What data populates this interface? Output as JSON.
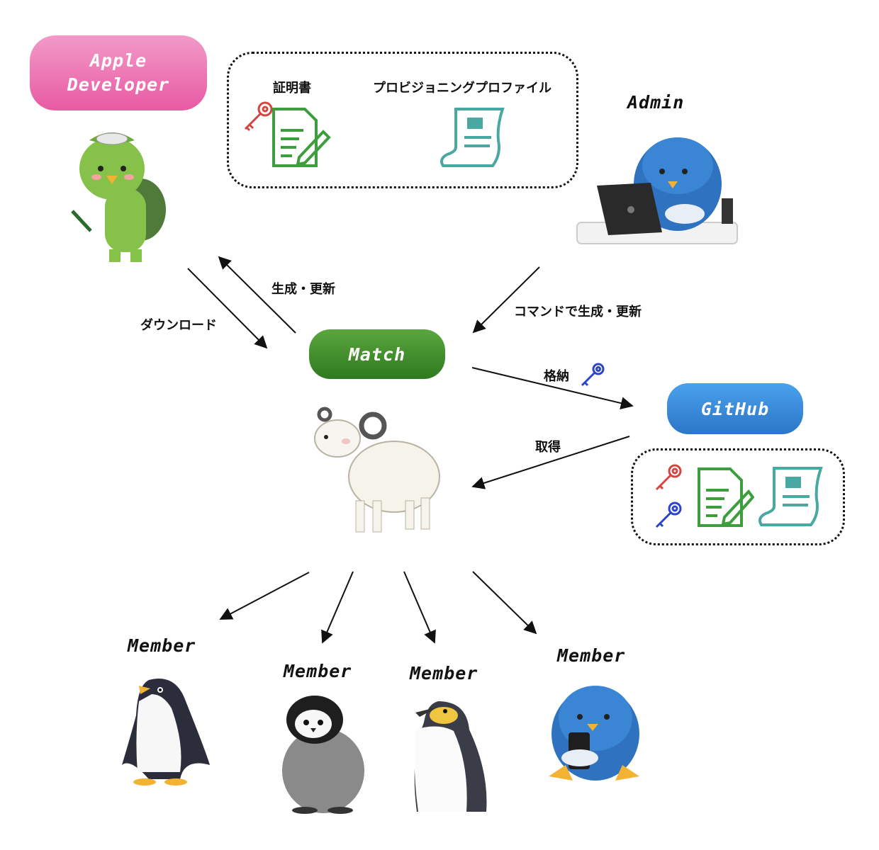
{
  "nodes": {
    "apple_developer": "Apple\nDeveloper",
    "match": "Match",
    "github": "GitHub"
  },
  "top_box": {
    "certificate_label": "証明書",
    "profile_label": "プロビジョニングプロファイル"
  },
  "roles": {
    "admin": "Admin",
    "members": [
      "Member",
      "Member",
      "Member",
      "Member"
    ]
  },
  "edges": {
    "download": "ダウンロード",
    "create_update": "生成・更新",
    "command_create_update": "コマンドで生成・更新",
    "store": "格納",
    "fetch": "取得"
  },
  "colors": {
    "apple_pill": "#e85aa3",
    "match_pill": "#3a8a28",
    "github_pill": "#3a8fdc",
    "key_red": "#d5453f",
    "key_blue": "#2a45c8",
    "doc_green": "#3c9e3c",
    "scroll_teal": "#4aa8a2"
  },
  "icons": [
    "kappa-character-icon",
    "penguin-laptop-icon",
    "sheep-icon",
    "key-icon",
    "certificate-document-icon",
    "provisioning-scroll-icon",
    "penguin-icon",
    "penguin-chick-icon",
    "king-penguin-icon",
    "penguin-smartphone-icon"
  ]
}
